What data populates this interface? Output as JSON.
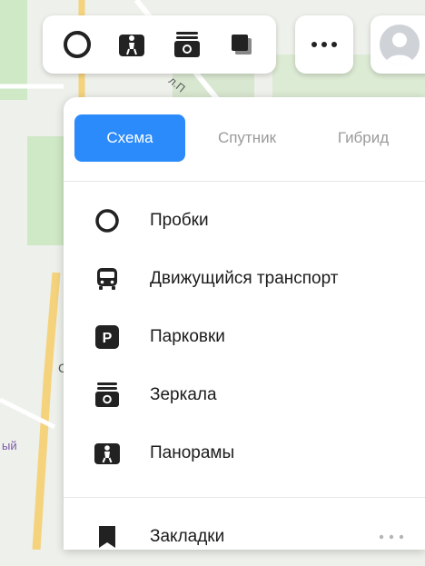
{
  "toolbar": {
    "icons": [
      "traffic-icon",
      "panorama-icon",
      "camera-icon",
      "layers-icon"
    ]
  },
  "top_right": {
    "more_icon": "more-dots-icon",
    "avatar_icon": "user-avatar-icon"
  },
  "layers_panel": {
    "tabs": [
      {
        "label": "Схема",
        "active": true
      },
      {
        "label": "Спутник",
        "active": false
      },
      {
        "label": "Гибрид",
        "active": false
      }
    ],
    "items": [
      {
        "label": "Пробки",
        "icon": "traffic-icon"
      },
      {
        "label": "Движущийся транспорт",
        "icon": "bus-icon"
      },
      {
        "label": "Парковки",
        "icon": "parking-icon"
      },
      {
        "label": "Зеркала",
        "icon": "camera-icon"
      },
      {
        "label": "Панорамы",
        "icon": "panorama-icon"
      }
    ],
    "bookmarks": {
      "label": "Закладки",
      "icon": "bookmark-icon"
    },
    "parking_letter": "P"
  },
  "colors": {
    "accent": "#2b8bfb",
    "text": "#1b1b1b",
    "muted": "#9a9a9a",
    "icon": "#222222"
  }
}
